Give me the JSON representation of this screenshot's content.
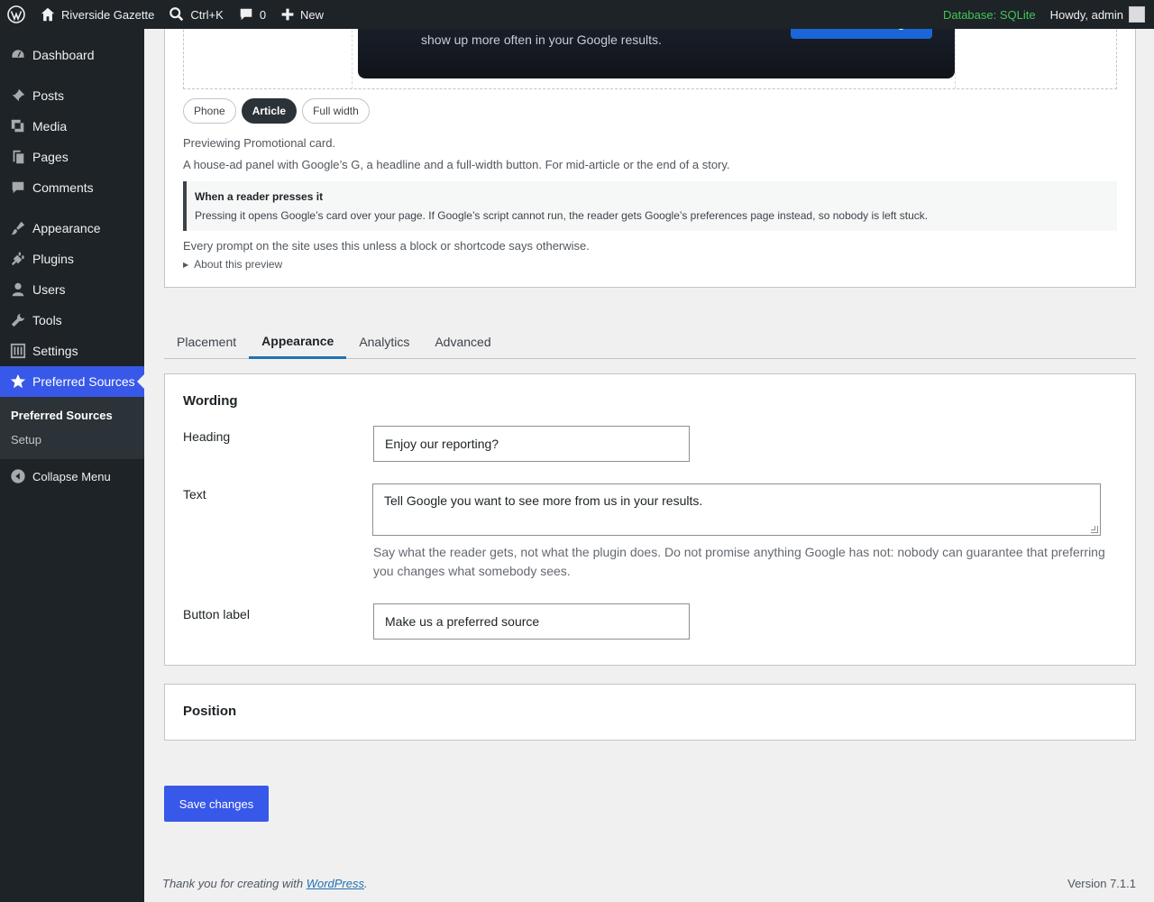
{
  "adminbar": {
    "site_name": "Riverside Gazette",
    "search_shortcut": "Ctrl+K",
    "comments_count": "0",
    "new_label": "New",
    "database": "Database: SQLite",
    "howdy": "Howdy, admin"
  },
  "sidebar": {
    "items": [
      {
        "label": "Dashboard",
        "icon": "dashboard-icon"
      },
      {
        "label": "Posts",
        "icon": "pin-icon"
      },
      {
        "label": "Media",
        "icon": "media-icon"
      },
      {
        "label": "Pages",
        "icon": "pages-icon"
      },
      {
        "label": "Comments",
        "icon": "comment-icon"
      },
      {
        "label": "Appearance",
        "icon": "brush-icon"
      },
      {
        "label": "Plugins",
        "icon": "plug-icon"
      },
      {
        "label": "Users",
        "icon": "user-icon"
      },
      {
        "label": "Tools",
        "icon": "wrench-icon"
      },
      {
        "label": "Settings",
        "icon": "settings-icon"
      },
      {
        "label": "Preferred Sources",
        "icon": "star-icon"
      }
    ],
    "submenu": [
      "Preferred Sources",
      "Setup"
    ],
    "collapse_label": "Collapse Menu"
  },
  "preview": {
    "promo_text": "Add Riverside Gazette as a preferred source and our stories show up more often in your Google results.",
    "promo_button": "Add us on Google",
    "modes": [
      "Phone",
      "Article",
      "Full width"
    ],
    "active_mode": "Article",
    "previewing": "Previewing Promotional card.",
    "description": "A house-ad panel with Google’s G, a headline and a full-width button. For mid-article or the end of a story.",
    "callout_title": "When a reader presses it",
    "callout_body": "Pressing it opens Google’s card over your page. If Google’s script cannot run, the reader gets Google’s preferences page instead, so nobody is left stuck.",
    "default_note": "Every prompt on the site uses this unless a block or shortcode says otherwise.",
    "about": "About this preview"
  },
  "tabs": [
    "Placement",
    "Appearance",
    "Analytics",
    "Advanced"
  ],
  "active_tab": "Appearance",
  "wording": {
    "title": "Wording",
    "heading_label": "Heading",
    "heading_value": "Enjoy our reporting?",
    "text_label": "Text",
    "text_value": "Tell Google you want to see more from us in your results.",
    "help": "Say what the reader gets, not what the plugin does. Do not promise anything Google has not: nobody can guarantee that preferring you changes what somebody sees.",
    "button_label": "Button label",
    "button_value": "Make us a preferred source"
  },
  "position": {
    "title": "Position"
  },
  "save_label": "Save changes",
  "footer": {
    "thanks_prefix": "Thank you for creating with ",
    "thanks_link": "WordPress",
    "thanks_suffix": ".",
    "version": "Version 7.1.1"
  },
  "colors": {
    "accent": "#3858e9",
    "sidebar_bg": "#1d2327",
    "database_status": "#42c55b"
  }
}
